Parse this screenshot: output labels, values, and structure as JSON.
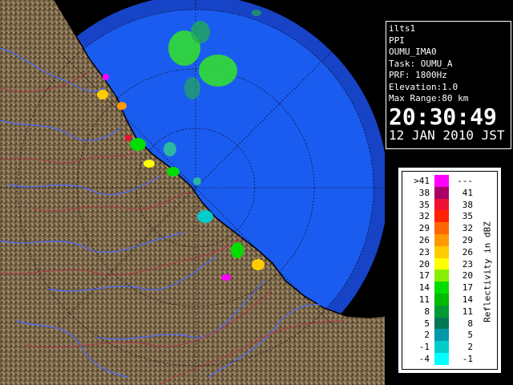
{
  "info": {
    "site": "ilts1",
    "product": "PPI",
    "station": "OUMU_IMA0",
    "task": "Task: OUMU_A",
    "prf": "PRF: 1800Hz",
    "elevation": "Elevation:1.0",
    "max_range": "Max Range:80 km",
    "time": "20:30:49",
    "date": "12 JAN 2010 JST"
  },
  "legend": {
    "unit_label": "Reflectivity in dBZ",
    "rows": [
      {
        "lo": ">41",
        "hi": "---",
        "color": "#ff00ff"
      },
      {
        "lo": "38",
        "hi": "41",
        "color": "#aa0066"
      },
      {
        "lo": "35",
        "hi": "38",
        "color": "#ee1133"
      },
      {
        "lo": "32",
        "hi": "35",
        "color": "#ff2200"
      },
      {
        "lo": "29",
        "hi": "32",
        "color": "#ff6600"
      },
      {
        "lo": "26",
        "hi": "29",
        "color": "#ff9900"
      },
      {
        "lo": "23",
        "hi": "26",
        "color": "#ffcc00"
      },
      {
        "lo": "20",
        "hi": "23",
        "color": "#ffff00"
      },
      {
        "lo": "17",
        "hi": "20",
        "color": "#88ee00"
      },
      {
        "lo": "14",
        "hi": "17",
        "color": "#00dd00"
      },
      {
        "lo": "11",
        "hi": "14",
        "color": "#00bb00"
      },
      {
        "lo": "8",
        "hi": "11",
        "color": "#009933"
      },
      {
        "lo": "5",
        "hi": "8",
        "color": "#007755"
      },
      {
        "lo": "2",
        "hi": "5",
        "color": "#0099aa"
      },
      {
        "lo": "-1",
        "hi": "2",
        "color": "#00cccc"
      },
      {
        "lo": "-4",
        "hi": "-1",
        "color": "#00ffff"
      }
    ]
  },
  "map": {
    "sea_color": "#1a5cf0",
    "outer_sea_color": "#1744c8",
    "land_color": "#7a6548",
    "river_color": "#4466ff",
    "border_color": "#aa3344",
    "echo_color": "#33dd33"
  }
}
